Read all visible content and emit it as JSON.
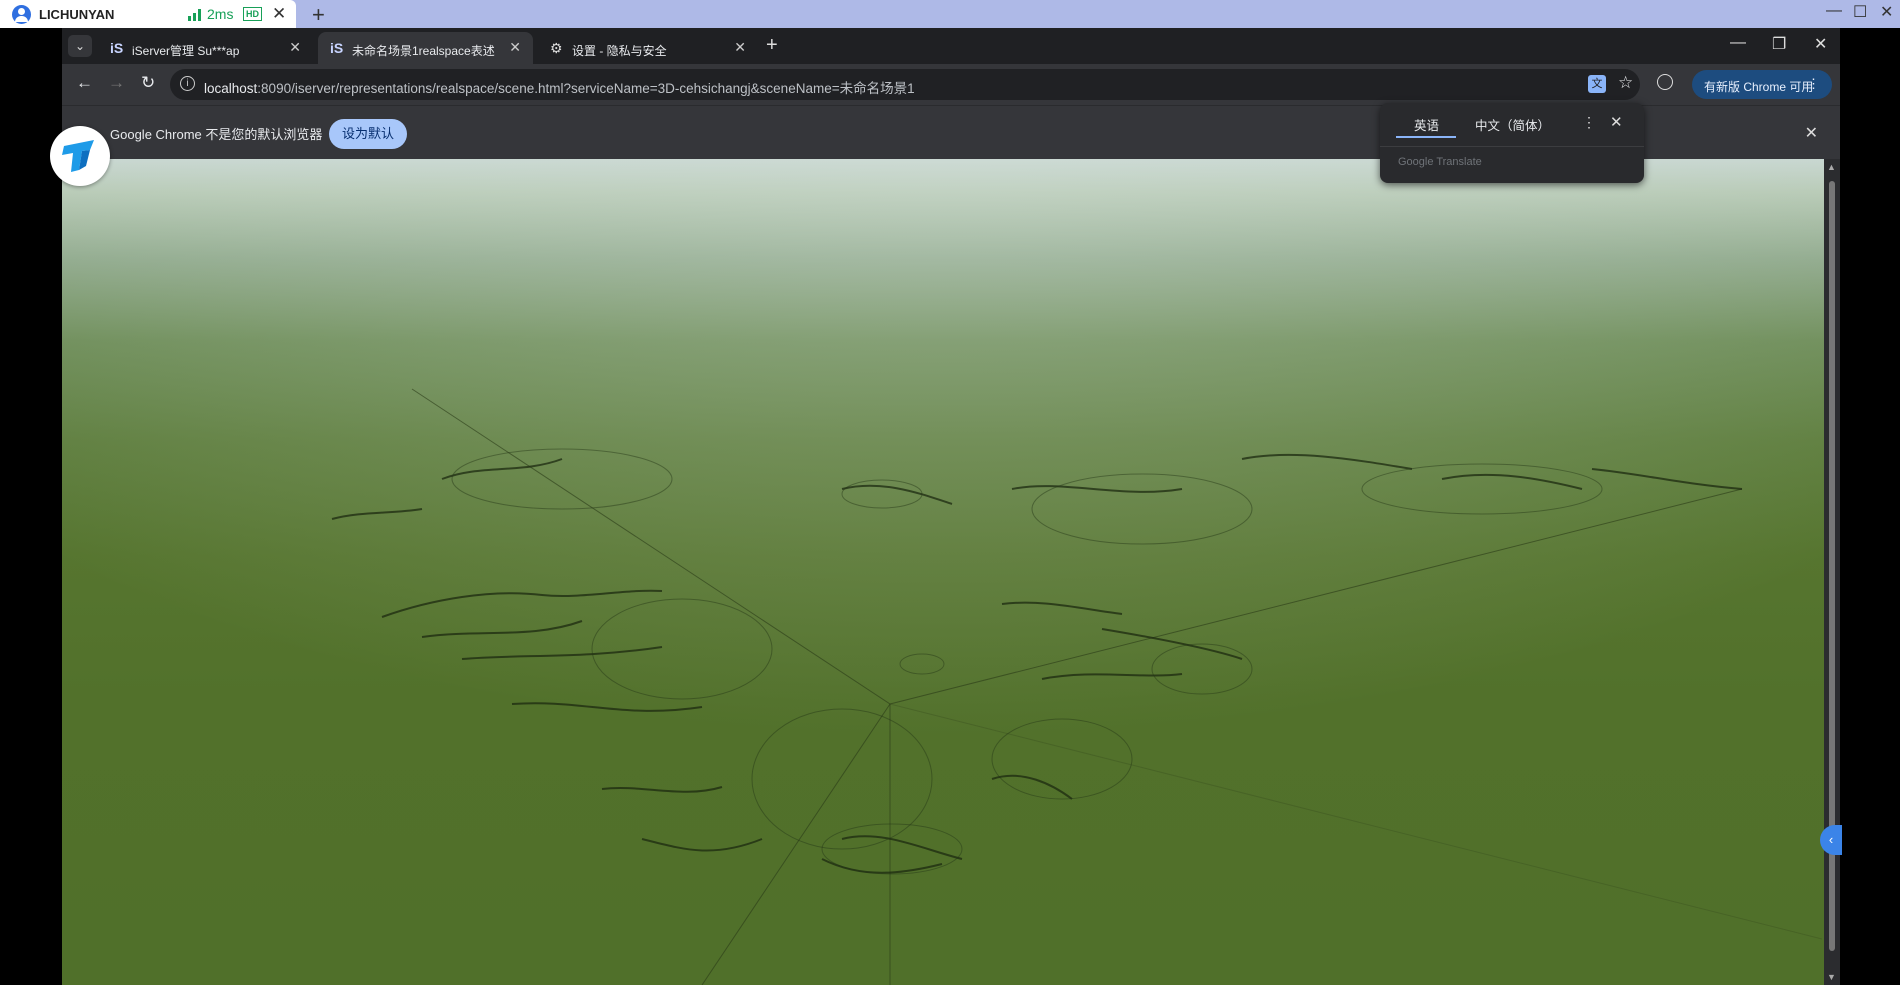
{
  "remote_session": {
    "user": "LICHUNYAN",
    "latency": "2ms",
    "quality_badge": "HD",
    "window_controls": [
      "minimize",
      "maximize",
      "close"
    ]
  },
  "browser": {
    "tabs": [
      {
        "icon_text": "iS",
        "title": "iServer管理 Su***ap",
        "active": false
      },
      {
        "icon_text": "iS",
        "title": "未命名场景1realspace表述",
        "active": true
      },
      {
        "icon_text": "⚙",
        "title": "设置 - 隐私与安全",
        "active": false
      }
    ],
    "address_bar": {
      "host": "localhost",
      "rest": ":8090/iserver/representations/realspace/scene.html?serviceName=3D-cehsichangj&sceneName=未命名场景1"
    },
    "update_button": "有新版 Chrome 可用",
    "infobar": {
      "message": "Google Chrome 不是您的默认浏览器",
      "button": "设为默认"
    }
  },
  "translate_popup": {
    "source_language": "英语",
    "target_language": "中文（简体）",
    "brand": "Google Translate"
  },
  "colors": {
    "remote_bar": "#aeb9e7",
    "browser_frame": "#202124",
    "toolbar": "#35363a",
    "accent_blue": "#a8c7fa",
    "terrain_green": "#56752f"
  }
}
